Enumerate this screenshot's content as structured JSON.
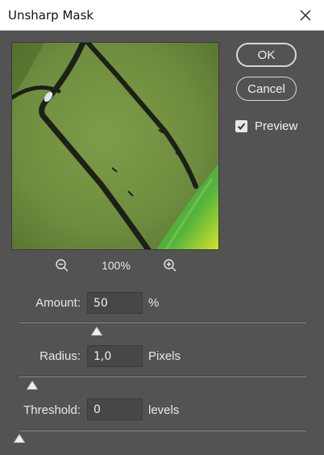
{
  "window": {
    "title": "Unsharp Mask"
  },
  "buttons": {
    "ok": "OK",
    "cancel": "Cancel"
  },
  "preview_toggle": {
    "label": "Preview",
    "checked": true
  },
  "zoom": {
    "level": "100%"
  },
  "params": {
    "amount": {
      "label": "Amount:",
      "value": "50",
      "unit": "%",
      "slider_fraction": 0.27
    },
    "radius": {
      "label": "Radius:",
      "value": "1,0",
      "unit": "Pixels",
      "slider_fraction": 0.045
    },
    "threshold": {
      "label": "Threshold:",
      "value": "0",
      "unit": "levels",
      "slider_fraction": 0.0
    }
  },
  "icons": [
    "close-icon",
    "checkmark-icon",
    "zoom-out-icon",
    "zoom-in-icon",
    "slider-thumb-icon"
  ],
  "colors": {
    "dialog_bg": "#535353",
    "title_bg": "#ffffff",
    "track": "#6e6e6e",
    "thumb": "#f0f0f0"
  }
}
